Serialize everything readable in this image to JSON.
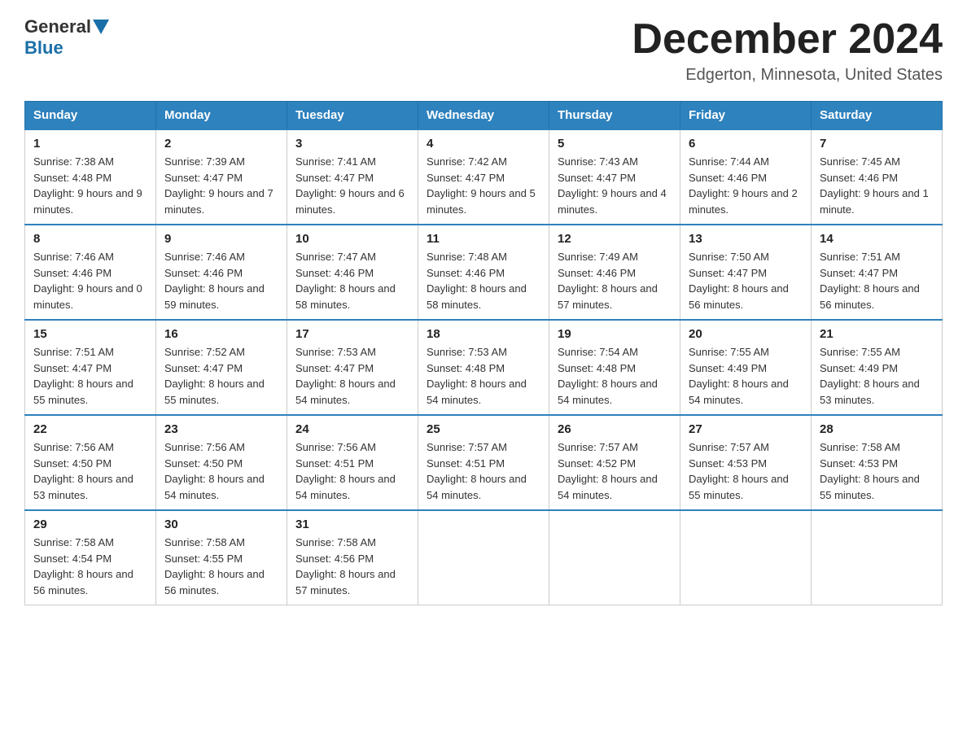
{
  "header": {
    "logo_general": "General",
    "logo_blue": "Blue",
    "month_title": "December 2024",
    "location": "Edgerton, Minnesota, United States"
  },
  "weekdays": [
    "Sunday",
    "Monday",
    "Tuesday",
    "Wednesday",
    "Thursday",
    "Friday",
    "Saturday"
  ],
  "weeks": [
    [
      {
        "day": "1",
        "sunrise": "7:38 AM",
        "sunset": "4:48 PM",
        "daylight": "9 hours and 9 minutes."
      },
      {
        "day": "2",
        "sunrise": "7:39 AM",
        "sunset": "4:47 PM",
        "daylight": "9 hours and 7 minutes."
      },
      {
        "day": "3",
        "sunrise": "7:41 AM",
        "sunset": "4:47 PM",
        "daylight": "9 hours and 6 minutes."
      },
      {
        "day": "4",
        "sunrise": "7:42 AM",
        "sunset": "4:47 PM",
        "daylight": "9 hours and 5 minutes."
      },
      {
        "day": "5",
        "sunrise": "7:43 AM",
        "sunset": "4:47 PM",
        "daylight": "9 hours and 4 minutes."
      },
      {
        "day": "6",
        "sunrise": "7:44 AM",
        "sunset": "4:46 PM",
        "daylight": "9 hours and 2 minutes."
      },
      {
        "day": "7",
        "sunrise": "7:45 AM",
        "sunset": "4:46 PM",
        "daylight": "9 hours and 1 minute."
      }
    ],
    [
      {
        "day": "8",
        "sunrise": "7:46 AM",
        "sunset": "4:46 PM",
        "daylight": "9 hours and 0 minutes."
      },
      {
        "day": "9",
        "sunrise": "7:46 AM",
        "sunset": "4:46 PM",
        "daylight": "8 hours and 59 minutes."
      },
      {
        "day": "10",
        "sunrise": "7:47 AM",
        "sunset": "4:46 PM",
        "daylight": "8 hours and 58 minutes."
      },
      {
        "day": "11",
        "sunrise": "7:48 AM",
        "sunset": "4:46 PM",
        "daylight": "8 hours and 58 minutes."
      },
      {
        "day": "12",
        "sunrise": "7:49 AM",
        "sunset": "4:46 PM",
        "daylight": "8 hours and 57 minutes."
      },
      {
        "day": "13",
        "sunrise": "7:50 AM",
        "sunset": "4:47 PM",
        "daylight": "8 hours and 56 minutes."
      },
      {
        "day": "14",
        "sunrise": "7:51 AM",
        "sunset": "4:47 PM",
        "daylight": "8 hours and 56 minutes."
      }
    ],
    [
      {
        "day": "15",
        "sunrise": "7:51 AM",
        "sunset": "4:47 PM",
        "daylight": "8 hours and 55 minutes."
      },
      {
        "day": "16",
        "sunrise": "7:52 AM",
        "sunset": "4:47 PM",
        "daylight": "8 hours and 55 minutes."
      },
      {
        "day": "17",
        "sunrise": "7:53 AM",
        "sunset": "4:47 PM",
        "daylight": "8 hours and 54 minutes."
      },
      {
        "day": "18",
        "sunrise": "7:53 AM",
        "sunset": "4:48 PM",
        "daylight": "8 hours and 54 minutes."
      },
      {
        "day": "19",
        "sunrise": "7:54 AM",
        "sunset": "4:48 PM",
        "daylight": "8 hours and 54 minutes."
      },
      {
        "day": "20",
        "sunrise": "7:55 AM",
        "sunset": "4:49 PM",
        "daylight": "8 hours and 54 minutes."
      },
      {
        "day": "21",
        "sunrise": "7:55 AM",
        "sunset": "4:49 PM",
        "daylight": "8 hours and 53 minutes."
      }
    ],
    [
      {
        "day": "22",
        "sunrise": "7:56 AM",
        "sunset": "4:50 PM",
        "daylight": "8 hours and 53 minutes."
      },
      {
        "day": "23",
        "sunrise": "7:56 AM",
        "sunset": "4:50 PM",
        "daylight": "8 hours and 54 minutes."
      },
      {
        "day": "24",
        "sunrise": "7:56 AM",
        "sunset": "4:51 PM",
        "daylight": "8 hours and 54 minutes."
      },
      {
        "day": "25",
        "sunrise": "7:57 AM",
        "sunset": "4:51 PM",
        "daylight": "8 hours and 54 minutes."
      },
      {
        "day": "26",
        "sunrise": "7:57 AM",
        "sunset": "4:52 PM",
        "daylight": "8 hours and 54 minutes."
      },
      {
        "day": "27",
        "sunrise": "7:57 AM",
        "sunset": "4:53 PM",
        "daylight": "8 hours and 55 minutes."
      },
      {
        "day": "28",
        "sunrise": "7:58 AM",
        "sunset": "4:53 PM",
        "daylight": "8 hours and 55 minutes."
      }
    ],
    [
      {
        "day": "29",
        "sunrise": "7:58 AM",
        "sunset": "4:54 PM",
        "daylight": "8 hours and 56 minutes."
      },
      {
        "day": "30",
        "sunrise": "7:58 AM",
        "sunset": "4:55 PM",
        "daylight": "8 hours and 56 minutes."
      },
      {
        "day": "31",
        "sunrise": "7:58 AM",
        "sunset": "4:56 PM",
        "daylight": "8 hours and 57 minutes."
      },
      null,
      null,
      null,
      null
    ]
  ],
  "labels": {
    "sunrise": "Sunrise:",
    "sunset": "Sunset:",
    "daylight": "Daylight:"
  }
}
